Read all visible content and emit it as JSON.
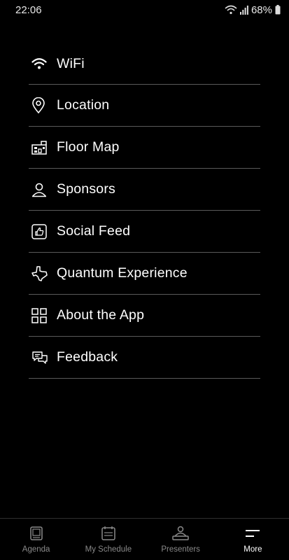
{
  "status_bar": {
    "time": "22:06",
    "battery": "68%"
  },
  "menu": {
    "items": [
      {
        "label": "WiFi",
        "icon": "wifi-icon"
      },
      {
        "label": "Location",
        "icon": "location-pin-icon"
      },
      {
        "label": "Floor Map",
        "icon": "floor-map-icon"
      },
      {
        "label": "Sponsors",
        "icon": "person-icon"
      },
      {
        "label": "Social Feed",
        "icon": "thumbs-up-icon"
      },
      {
        "label": "Quantum Experience",
        "icon": "texas-map-icon"
      },
      {
        "label": "About the App",
        "icon": "grid-icon"
      },
      {
        "label": "Feedback",
        "icon": "chat-bubbles-icon"
      }
    ]
  },
  "tabbar": {
    "tabs": [
      {
        "label": "Agenda",
        "icon": "agenda-icon"
      },
      {
        "label": "My Schedule",
        "icon": "calendar-icon"
      },
      {
        "label": "Presenters",
        "icon": "presenter-icon"
      },
      {
        "label": "More",
        "icon": "menu-lines-icon",
        "active": true
      }
    ]
  },
  "colors": {
    "background": "#000000",
    "text": "#ffffff",
    "divider": "#5a5a5a",
    "inactive_tab": "#8a8a8a"
  }
}
